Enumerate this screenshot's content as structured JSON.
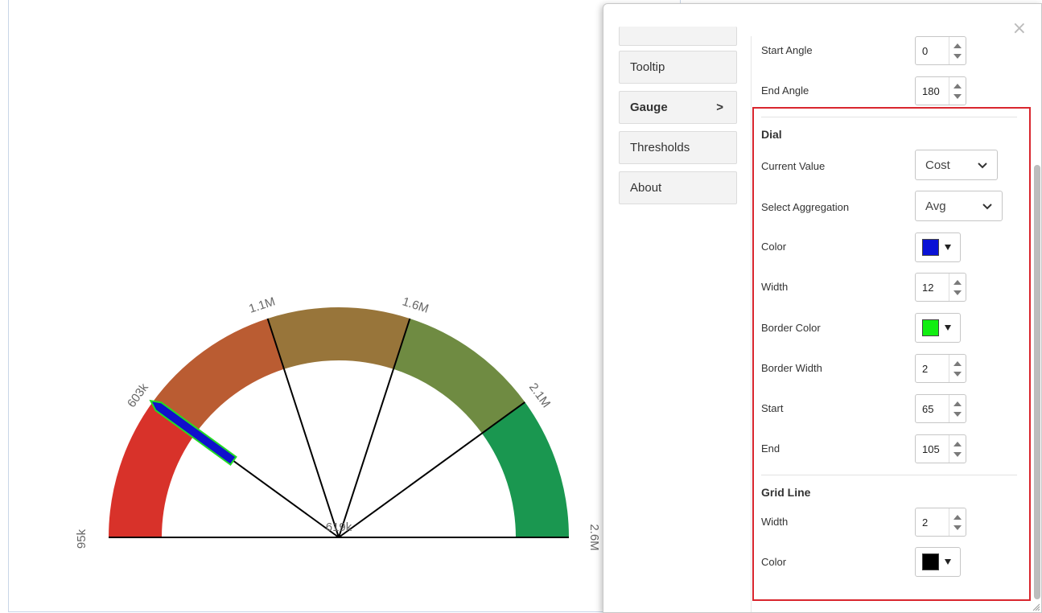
{
  "gauge": {
    "min_label": "95k",
    "max_label": "2.6M",
    "center_label": "619k",
    "tick_labels": [
      "603k",
      "1.1M",
      "1.6M",
      "2.1M"
    ],
    "band_colors": [
      "#d8322a",
      "#ba5c32",
      "#98753a",
      "#6f8b42",
      "#1a9750"
    ],
    "needle_fill": "#1010cc",
    "needle_border": "#22dd22",
    "grid_line_color": "#000000",
    "current_value_fraction": 0.2
  },
  "panel": {
    "nav": [
      {
        "label": "Tooltip"
      },
      {
        "label": "Gauge",
        "chevron": ">"
      },
      {
        "label": "Thresholds"
      },
      {
        "label": "About"
      }
    ],
    "close_label": "×",
    "start_angle": {
      "label": "Start Angle",
      "value": "0"
    },
    "end_angle": {
      "label": "End Angle",
      "value": "180"
    },
    "dial": {
      "title": "Dial",
      "current_value": {
        "label": "Current Value",
        "value": "Cost"
      },
      "aggregation": {
        "label": "Select Aggregation",
        "value": "Avg"
      },
      "color": {
        "label": "Color",
        "value": "#0a12d6"
      },
      "width": {
        "label": "Width",
        "value": "12"
      },
      "border_color": {
        "label": "Border Color",
        "value": "#11ee11"
      },
      "border_width": {
        "label": "Border Width",
        "value": "2"
      },
      "start": {
        "label": "Start",
        "value": "65"
      },
      "end": {
        "label": "End",
        "value": "105"
      }
    },
    "grid_line": {
      "title": "Grid Line",
      "width": {
        "label": "Width",
        "value": "2"
      },
      "color": {
        "label": "Color",
        "value": "#000000"
      }
    }
  }
}
